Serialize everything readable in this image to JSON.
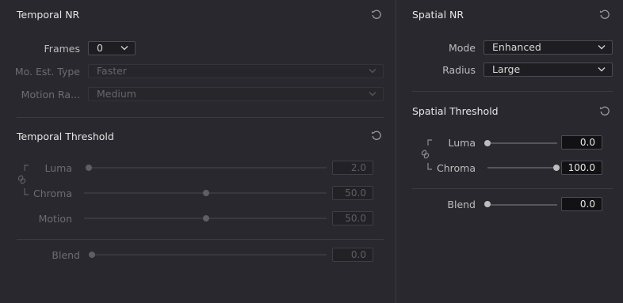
{
  "temporal_nr": {
    "title": "Temporal NR",
    "frames": {
      "label": "Frames",
      "value": "0"
    },
    "mo_est_type": {
      "label": "Mo. Est. Type",
      "value": "Faster"
    },
    "motion_range": {
      "label": "Motion Ra...",
      "value": "Medium"
    }
  },
  "temporal_threshold": {
    "title": "Temporal Threshold",
    "luma": {
      "label": "Luma",
      "value": "2.0",
      "level": 0.0
    },
    "chroma": {
      "label": "Chroma",
      "value": "50.0",
      "level": 0.5
    },
    "motion": {
      "label": "Motion",
      "value": "50.0",
      "level": 0.5
    },
    "blend": {
      "label": "Blend",
      "value": "0.0",
      "level": 0.0
    }
  },
  "spatial_nr": {
    "title": "Spatial NR",
    "mode": {
      "label": "Mode",
      "value": "Enhanced"
    },
    "radius": {
      "label": "Radius",
      "value": "Large"
    }
  },
  "spatial_threshold": {
    "title": "Spatial Threshold",
    "luma": {
      "label": "Luma",
      "value": "0.0",
      "level": 0.0
    },
    "chroma": {
      "label": "Chroma",
      "value": "100.0",
      "level": 1.0
    },
    "blend": {
      "label": "Blend",
      "value": "0.0",
      "level": 0.0
    }
  },
  "icons": {
    "reset": "reset-icon",
    "link": "link-icon",
    "dropdown": "chevron-down-icon"
  },
  "colors": {
    "background": "#28282e",
    "enabled_text": "#bdbdbd",
    "disabled_text": "#6c6c72"
  }
}
